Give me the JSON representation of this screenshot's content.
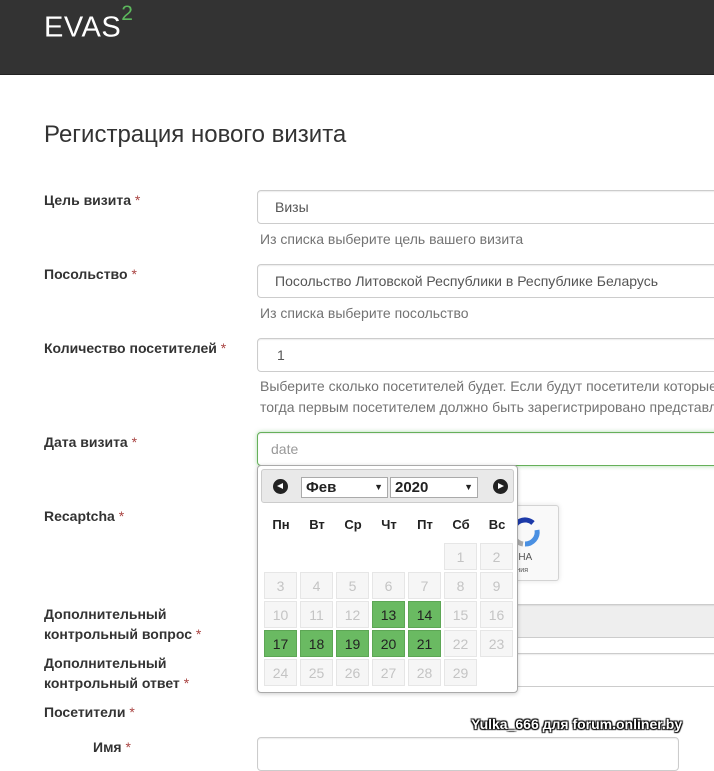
{
  "brand": {
    "name": "EVAS",
    "sup": "2"
  },
  "page_title": "Регистрация нового визита",
  "required_mark": "*",
  "form": {
    "purpose": {
      "label": "Цель визита",
      "value": "Визы",
      "help": "Из списка выберите цель вашего визита"
    },
    "embassy": {
      "label": "Посольство",
      "value": "Посольство Литовской Республики в Республике Беларусь",
      "help": "Из списка выберите посольство"
    },
    "visitors_count": {
      "label": "Количество посетителей",
      "value": "1",
      "help_line1": "Выберите сколько посетителей будет. Если будут посетители которые",
      "help_line2": "тогда первым посетителем должно быть зарегистрировано представл"
    },
    "visit_date": {
      "label": "Дата визита",
      "placeholder": "date"
    },
    "recaptcha": {
      "label": "Recaptcha",
      "text": "TCHA",
      "sub": "ования"
    },
    "extra_question": {
      "label_line1": "Дополнительный",
      "label_line2": "контрольный вопрос"
    },
    "extra_answer": {
      "label_line1": "Дополнительный",
      "label_line2": "контрольный ответ"
    },
    "visitors": {
      "label": "Посетители"
    },
    "name": {
      "label": "Имя"
    }
  },
  "datepicker": {
    "month": "Фев",
    "year": "2020",
    "weekdays": [
      "Пн",
      "Вт",
      "Ср",
      "Чт",
      "Пт",
      "Сб",
      "Вс"
    ],
    "days": [
      [
        null,
        null,
        null,
        null,
        null,
        "1",
        "2"
      ],
      [
        "3",
        "4",
        "5",
        "6",
        "7",
        "8",
        "9"
      ],
      [
        "10",
        "11",
        "12",
        "13",
        "14",
        "15",
        "16"
      ],
      [
        "17",
        "18",
        "19",
        "20",
        "21",
        "22",
        "23"
      ],
      [
        "24",
        "25",
        "26",
        "27",
        "28",
        "29",
        null
      ]
    ],
    "available": [
      "13",
      "14",
      "17",
      "18",
      "19",
      "20",
      "21"
    ],
    "available_color": "#6aba62"
  },
  "watermark": "Yulka_666 для forum.onliner.by"
}
